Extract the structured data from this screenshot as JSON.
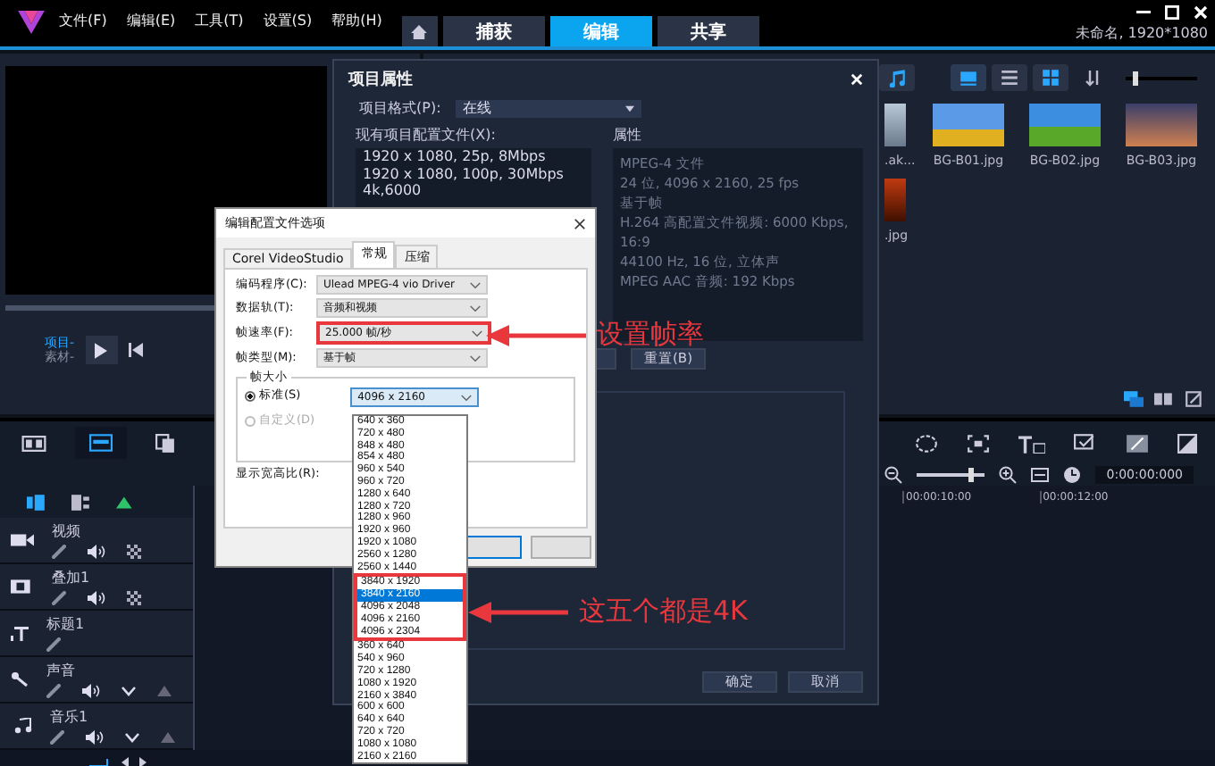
{
  "title_bar": {
    "menus": [
      "文件(F)",
      "编辑(E)",
      "工具(T)",
      "设置(S)",
      "帮助(H)"
    ],
    "tabs": [
      {
        "label": "捕获",
        "selected": false
      },
      {
        "label": "编辑",
        "selected": true
      },
      {
        "label": "共享",
        "selected": false
      }
    ],
    "project_info": "未命名, 1920*1080"
  },
  "preview": {
    "labels": [
      "项目-",
      "素材-"
    ]
  },
  "library": {
    "size_slider": {
      "level": 0.1
    },
    "items": [
      {
        "name": ".ak..."
      },
      {
        "name": "BG-B01.jpg"
      },
      {
        "name": "BG-B02.jpg"
      },
      {
        "name": "BG-B03.jpg"
      },
      {
        "name": ".jpg"
      }
    ]
  },
  "timeline": {
    "zoom_slider": {
      "level": 0.75
    },
    "timecode": "0:00:00:000",
    "ruler": [
      "00:00:10:00",
      "00:00:12:00"
    ],
    "tracks": [
      {
        "name": "视频",
        "kind": "video"
      },
      {
        "name": "叠加1",
        "kind": "overlay"
      },
      {
        "name": "标题1",
        "kind": "title"
      },
      {
        "name": "声音",
        "kind": "voice"
      },
      {
        "name": "音乐1",
        "kind": "music"
      }
    ]
  },
  "project_dialog": {
    "title": "项目属性",
    "format_label": "项目格式(P):",
    "format_value": "在线",
    "profiles_label": "现有项目配置文件(X):",
    "profiles": [
      "1920 x 1080, 25p, 8Mbps",
      "1920 x 1080, 100p, 30Mbps",
      "4k,6000"
    ],
    "properties_label": "属性",
    "properties": [
      "MPEG-4 文件",
      "24 位, 4096 x 2160, 25 fps",
      "基于帧",
      "H.264 高配置文件视频: 6000 Kbps, 16:9",
      "44100 Hz, 16 位, 立体声",
      "MPEG AAC 音频: 192 Kbps"
    ],
    "reset_button": "重置(B)",
    "buttons": [
      "确定",
      "取消"
    ]
  },
  "profile_dialog": {
    "title": "编辑配置文件选项",
    "tabs": [
      {
        "label": "Corel VideoStudio",
        "selected": false
      },
      {
        "label": "常规",
        "selected": true
      },
      {
        "label": "压缩",
        "selected": false
      }
    ],
    "fields": [
      {
        "label": "编码程序(C):",
        "value": "Ulead MPEG-4 vio Driver",
        "highlighted": false
      },
      {
        "label": "数据轨(T):",
        "value": "音频和视频",
        "highlighted": false
      },
      {
        "label": "帧速率(F):",
        "value": "25.000 帧/秒",
        "highlighted": true
      },
      {
        "label": "帧类型(M):",
        "value": "基于帧",
        "highlighted": false
      }
    ],
    "frame_size": {
      "legend": "帧大小",
      "options": [
        {
          "label": "标准(S)",
          "selected": true,
          "disabled": false
        },
        {
          "label": "自定义(D)",
          "selected": false,
          "disabled": true
        }
      ],
      "value": "4096 x 2160"
    },
    "aspect_label": "显示宽高比(R):"
  },
  "size_list": {
    "items": [
      {
        "label": "640 x 360",
        "selected": false,
        "highlighted": false
      },
      {
        "label": "720 x 480",
        "selected": false,
        "highlighted": false
      },
      {
        "label": "848 x 480",
        "selected": false,
        "highlighted": false
      },
      {
        "label": "854 x 480",
        "selected": false,
        "highlighted": false
      },
      {
        "label": "960 x 540",
        "selected": false,
        "highlighted": false
      },
      {
        "label": "960 x 720",
        "selected": false,
        "highlighted": false
      },
      {
        "label": "1280 x 640",
        "selected": false,
        "highlighted": false
      },
      {
        "label": "1280 x 720",
        "selected": false,
        "highlighted": false
      },
      {
        "label": "1280 x 960",
        "selected": false,
        "highlighted": false
      },
      {
        "label": "1920 x 960",
        "selected": false,
        "highlighted": false
      },
      {
        "label": "1920 x 1080",
        "selected": false,
        "highlighted": false
      },
      {
        "label": "2560 x 1280",
        "selected": false,
        "highlighted": false
      },
      {
        "label": "2560 x 1440",
        "selected": false,
        "highlighted": false
      },
      {
        "label": "3840 x 1920",
        "selected": false,
        "highlighted": true
      },
      {
        "label": "3840 x 2160",
        "selected": true,
        "highlighted": true
      },
      {
        "label": "4096 x 2048",
        "selected": false,
        "highlighted": true
      },
      {
        "label": "4096 x 2160",
        "selected": false,
        "highlighted": true
      },
      {
        "label": "4096 x 2304",
        "selected": false,
        "highlighted": true
      },
      {
        "label": "360 x 640",
        "selected": false,
        "highlighted": false
      },
      {
        "label": "540 x 960",
        "selected": false,
        "highlighted": false
      },
      {
        "label": "720 x 1280",
        "selected": false,
        "highlighted": false
      },
      {
        "label": "1080 x 1920",
        "selected": false,
        "highlighted": false
      },
      {
        "label": "2160 x 3840",
        "selected": false,
        "highlighted": false
      },
      {
        "label": "600 x 600",
        "selected": false,
        "highlighted": false
      },
      {
        "label": "640 x 640",
        "selected": false,
        "highlighted": false
      },
      {
        "label": "720 x 720",
        "selected": false,
        "highlighted": false
      },
      {
        "label": "1080 x 1080",
        "selected": false,
        "highlighted": false
      },
      {
        "label": "2160 x 2160",
        "selected": false,
        "highlighted": false
      }
    ]
  },
  "annotations": [
    {
      "text": "设置帧率"
    },
    {
      "text": "这五个都是4K"
    }
  ]
}
